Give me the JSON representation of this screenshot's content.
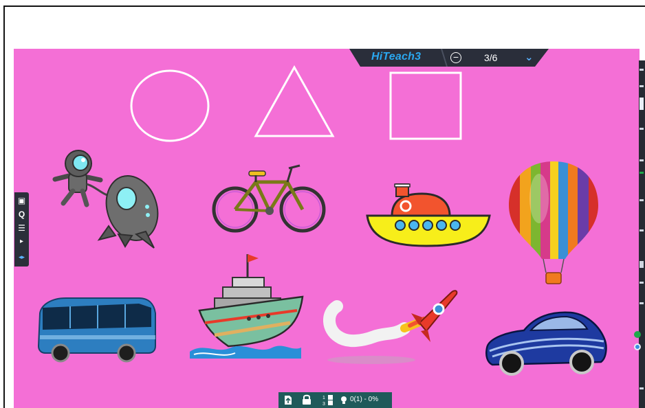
{
  "header": {
    "brand": "HiTeach",
    "brand_version": "3",
    "page_indicator": "3/6",
    "minus_symbol": "−",
    "chevron_symbol": "⌄"
  },
  "left_toolbar": {
    "items": [
      {
        "icon": "image-icon",
        "glyph": "▣"
      },
      {
        "icon": "q-icon",
        "glyph": "Q"
      },
      {
        "icon": "menu-icon",
        "glyph": "☰"
      },
      {
        "icon": "play-icon",
        "glyph": "▸"
      },
      {
        "icon": "switch-arrows-icon",
        "glyph": "◂▸"
      }
    ]
  },
  "bottom_bar": {
    "status": "0(1) - 0%"
  },
  "slide": {
    "background_color": "#f46fd6",
    "shapes": [
      "circle-outline",
      "triangle-outline",
      "square-outline"
    ],
    "pictures": [
      "astronaut",
      "space-capsule",
      "bicycle",
      "submarine",
      "hot-air-balloon",
      "bus",
      "ship",
      "rocket",
      "car"
    ]
  }
}
